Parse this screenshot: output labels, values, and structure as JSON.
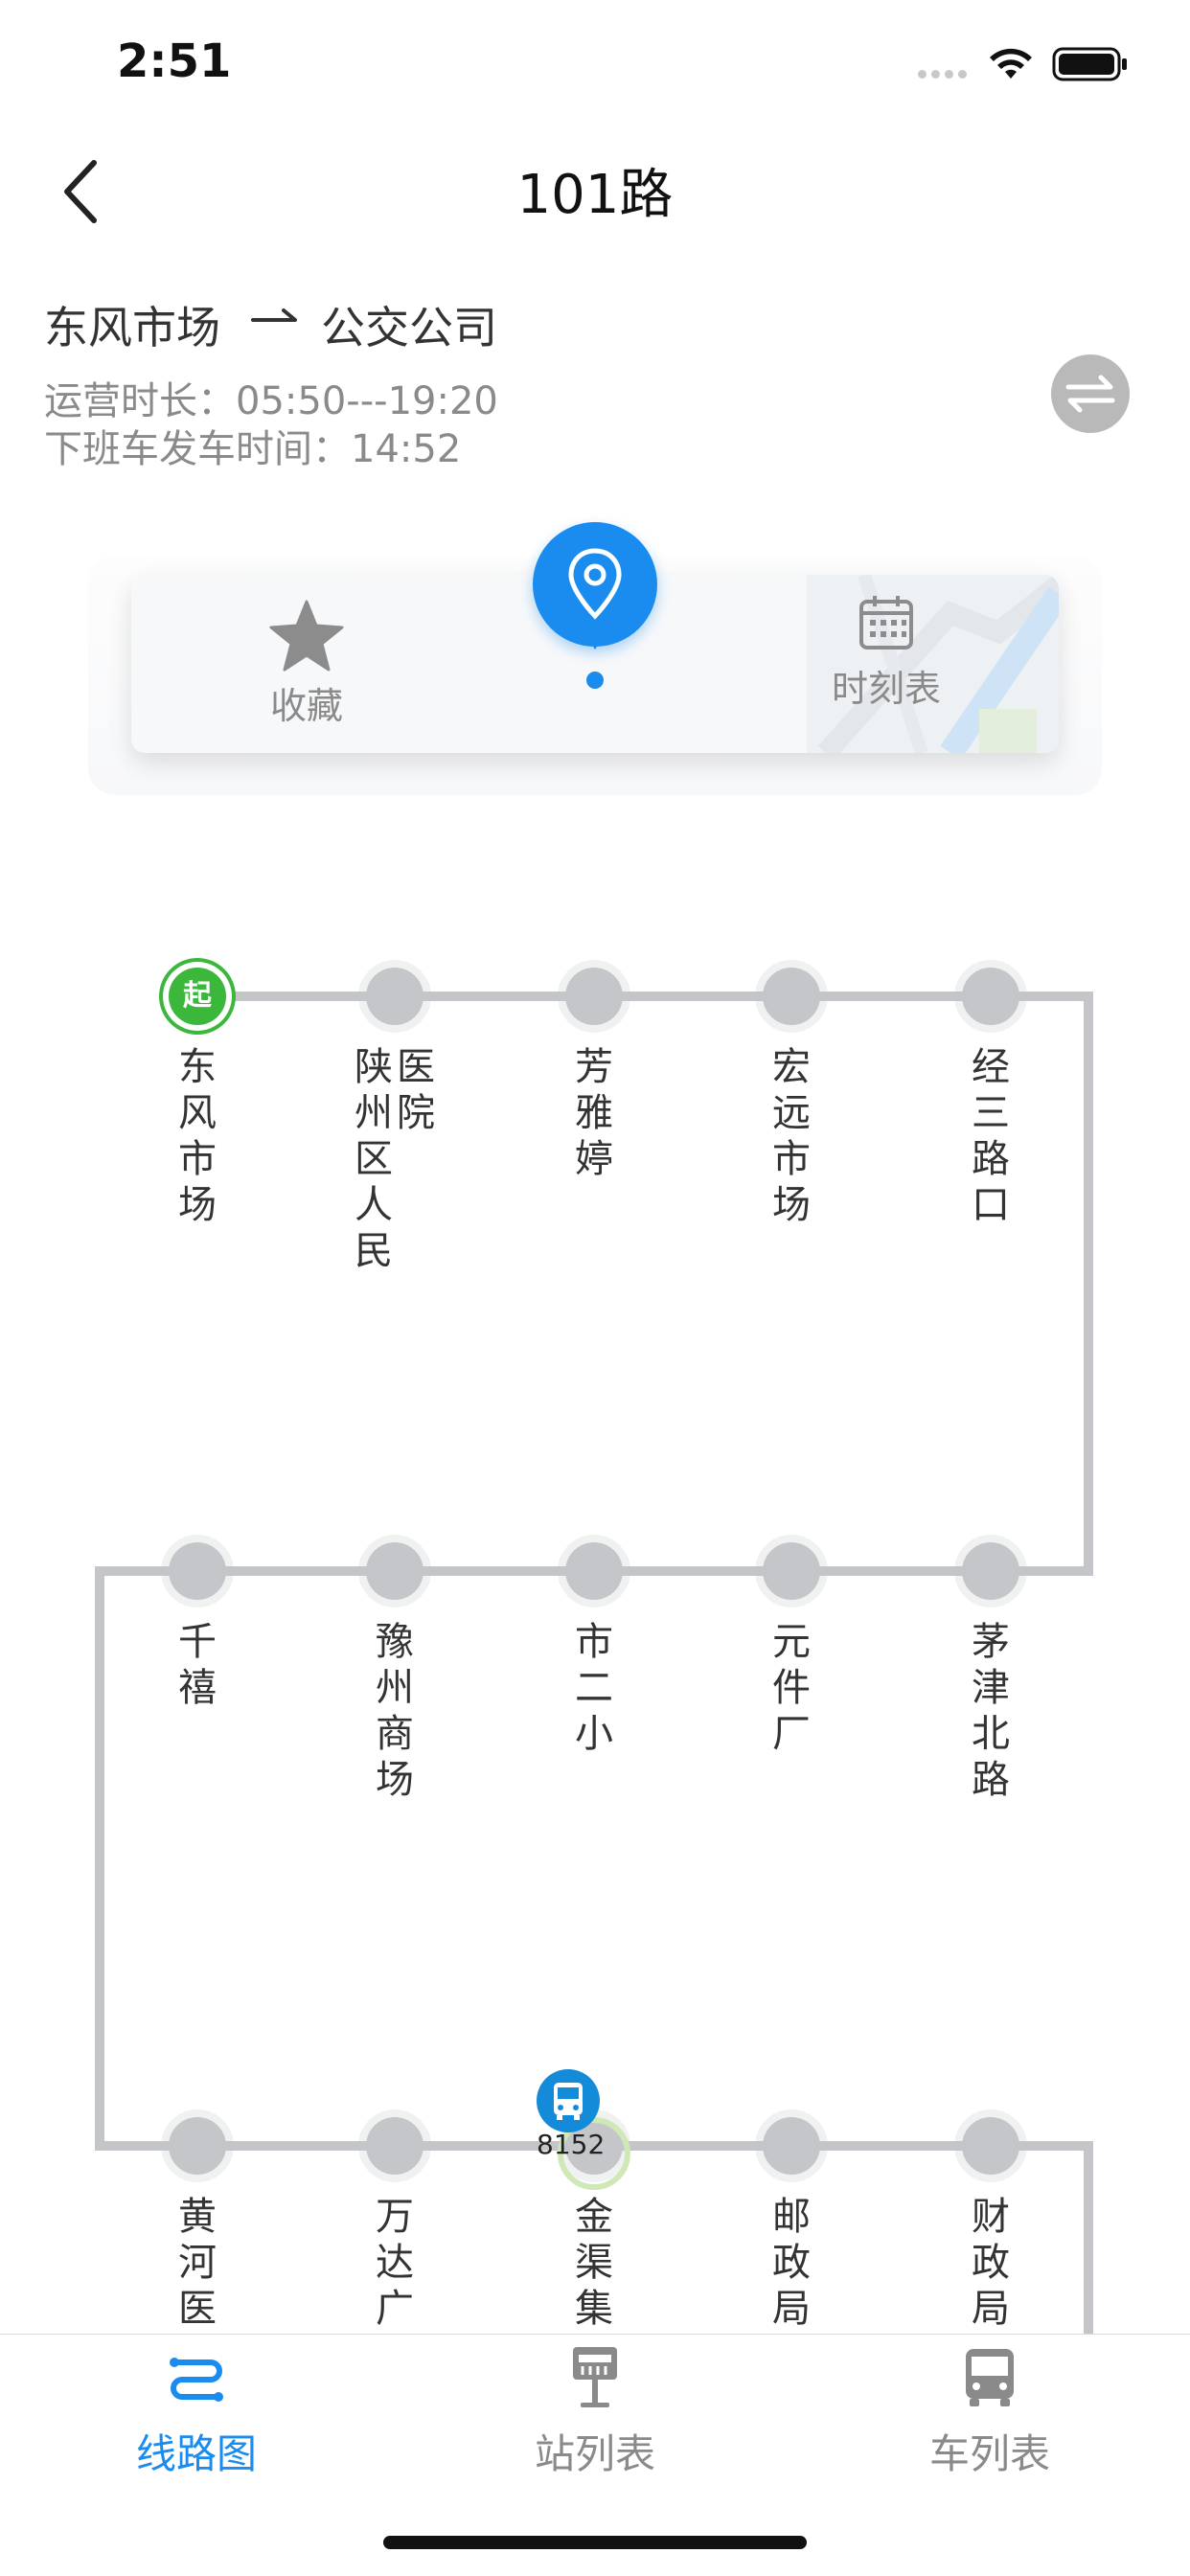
{
  "status_bar": {
    "time": "2:51"
  },
  "nav": {
    "title": "101路"
  },
  "route": {
    "from": "东风市场",
    "to": "公交公司",
    "operating_hours": "运营时长：05:50---19:20",
    "next_departure": "下班车发车时间：14:52"
  },
  "actions": {
    "favorite_label": "收藏",
    "timetable_label": "时刻表"
  },
  "stops": [
    {
      "name": "东风市场",
      "row": 1,
      "start_badge": "起"
    },
    {
      "name": "陕州区人民医院",
      "row": 1
    },
    {
      "name": "芳雅婷",
      "row": 1
    },
    {
      "name": "宏远市场",
      "row": 1
    },
    {
      "name": "经三路口",
      "row": 1
    },
    {
      "name": "茅津北路",
      "row": 2
    },
    {
      "name": "元件厂",
      "row": 2
    },
    {
      "name": "市二小",
      "row": 2
    },
    {
      "name": "豫州商场",
      "row": 2
    },
    {
      "name": "千禧",
      "row": 2
    },
    {
      "name": "黄河医",
      "row": 3
    },
    {
      "name": "万达广",
      "row": 3
    },
    {
      "name": "金渠集",
      "row": 3
    },
    {
      "name": "邮政局",
      "row": 3
    },
    {
      "name": "财政局",
      "row": 3
    }
  ],
  "bus": {
    "number": "8152"
  },
  "tabs": [
    {
      "label": "线路图",
      "active": true
    },
    {
      "label": "站列表",
      "active": false
    },
    {
      "label": "车列表",
      "active": false
    }
  ],
  "colors": {
    "accent": "#1a8cf0",
    "start": "#3bb83b",
    "inactive": "#8a8a8a",
    "stop": "#c4c6c9"
  }
}
